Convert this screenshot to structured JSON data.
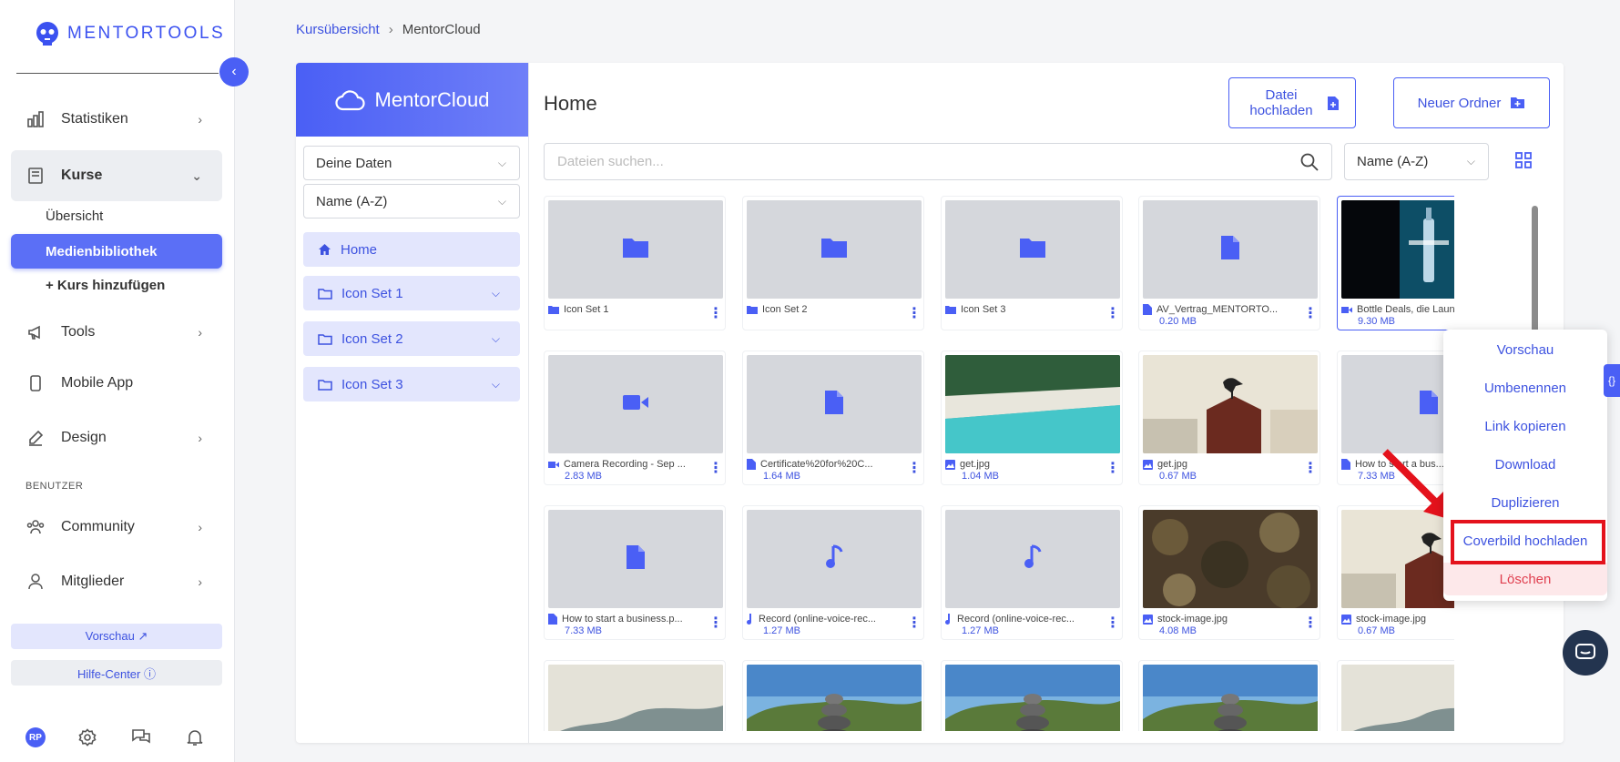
{
  "brand": {
    "name": "MENTORTOOLS"
  },
  "sidebar": {
    "items": [
      {
        "label": "Statistiken"
      },
      {
        "label": "Kurse"
      },
      {
        "label": "Tools"
      },
      {
        "label": "Mobile App"
      },
      {
        "label": "Design"
      },
      {
        "label": "Community"
      },
      {
        "label": "Mitglieder"
      }
    ],
    "sub_items": [
      "Übersicht",
      "Medienbibliothek",
      "+ Kurs hinzufügen"
    ],
    "section_label": "BENUTZER",
    "preview_button": "Vorschau ↗",
    "help_button": "Hilfe-Center ⓘ",
    "avatar_initials": "RP"
  },
  "breadcrumb": {
    "root": "Kursübersicht",
    "current": "MentorCloud"
  },
  "cloud": {
    "title": "MentorCloud",
    "data_select": "Deine Daten",
    "sort_select": "Name (A-Z)",
    "tree": [
      {
        "label": "Home"
      },
      {
        "label": "Icon Set 1"
      },
      {
        "label": "Icon Set 2"
      },
      {
        "label": "Icon Set 3"
      }
    ]
  },
  "main": {
    "title": "Home",
    "upload_button": "Datei hochladen",
    "new_folder_button": "Neuer Ordner",
    "search_placeholder": "Dateien suchen...",
    "sort": "Name (A-Z)"
  },
  "files": [
    {
      "name": "Icon Set 1",
      "size": "",
      "type": "folder",
      "thumb": "folder"
    },
    {
      "name": "Icon Set 2",
      "size": "",
      "type": "folder",
      "thumb": "folder"
    },
    {
      "name": "Icon Set 3",
      "size": "",
      "type": "folder",
      "thumb": "folder"
    },
    {
      "name": "AV_Vertrag_MENTORTO...",
      "size": "0.20 MB",
      "type": "doc",
      "thumb": "doc"
    },
    {
      "name": "Bottle Deals, die Laune m...",
      "size": "9.30 MB",
      "type": "video",
      "thumb": "bottle"
    },
    {
      "name": "Camera Recording - Sep ...",
      "size": "2.83 MB",
      "type": "video",
      "thumb": "video"
    },
    {
      "name": "Certificate%20for%20C...",
      "size": "1.64 MB",
      "type": "doc",
      "thumb": "doc"
    },
    {
      "name": "get.jpg",
      "size": "1.04 MB",
      "type": "image",
      "thumb": "beach"
    },
    {
      "name": "get.jpg",
      "size": "0.67 MB",
      "type": "image",
      "thumb": "bird"
    },
    {
      "name": "How to start a bus...",
      "size": "7.33 MB",
      "type": "doc",
      "thumb": "doc"
    },
    {
      "name": "How to start a business.p...",
      "size": "7.33 MB",
      "type": "doc",
      "thumb": "doc"
    },
    {
      "name": "Record (online-voice-rec...",
      "size": "1.27 MB",
      "type": "audio",
      "thumb": "audio"
    },
    {
      "name": "Record (online-voice-rec...",
      "size": "1.27 MB",
      "type": "audio",
      "thumb": "audio"
    },
    {
      "name": "stock-image.jpg",
      "size": "4.08 MB",
      "type": "image",
      "thumb": "leaves"
    },
    {
      "name": "stock-image.jpg",
      "size": "0.67 MB",
      "type": "image",
      "thumb": "bird"
    },
    {
      "name": "",
      "size": "",
      "type": "image",
      "thumb": "fog"
    },
    {
      "name": "",
      "size": "",
      "type": "image",
      "thumb": "stones"
    },
    {
      "name": "",
      "size": "",
      "type": "image",
      "thumb": "stones"
    },
    {
      "name": "",
      "size": "",
      "type": "image",
      "thumb": "stones"
    },
    {
      "name": "",
      "size": "",
      "type": "image",
      "thumb": "fog"
    }
  ],
  "context_menu": [
    "Vorschau",
    "Umbenennen",
    "Link kopieren",
    "Download",
    "Duplizieren",
    "Coverbild hochladen",
    "Löschen"
  ],
  "colors": {
    "accent": "#4a5ff5",
    "danger": "#e04050",
    "highlight": "#e4121c"
  }
}
